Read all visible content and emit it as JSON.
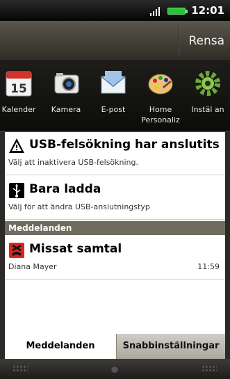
{
  "status_bar": {
    "time": "12:01"
  },
  "header": {
    "clear_label": "Rensa"
  },
  "apps": [
    {
      "label": "Kalender",
      "icon": "calendar-icon",
      "date": "15"
    },
    {
      "label": "Kamera",
      "icon": "camera-icon"
    },
    {
      "label": "E-post",
      "icon": "mail-icon"
    },
    {
      "label": "Home Personaliz",
      "icon": "palette-icon"
    },
    {
      "label": "Instäl an",
      "icon": "settings-gear-icon"
    }
  ],
  "notifications": [
    {
      "title": "USB-felsökning har anslutits",
      "subtitle": "Välj att inaktivera USB-felsökning.",
      "icon": "warning-icon"
    },
    {
      "title": "Bara ladda",
      "subtitle": "Välj för att ändra USB-anslutningstyp",
      "icon": "usb-icon"
    }
  ],
  "messages_section": {
    "heading": "Meddelanden",
    "items": [
      {
        "title": "Missat samtal",
        "caller": "Diana Mayer",
        "time": "11:59",
        "icon": "missed-call-icon"
      }
    ]
  },
  "tabs": [
    {
      "label": "Meddelanden",
      "active": true
    },
    {
      "label": "Snabbinställningar",
      "active": false
    }
  ],
  "colors": {
    "section_header": "#6f6b5e",
    "battery": "#26c43a",
    "missed_call": "#d9261c"
  }
}
